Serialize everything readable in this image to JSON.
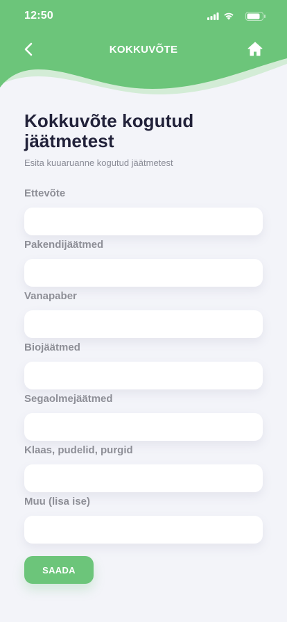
{
  "colors": {
    "accent": "#6cc57a",
    "accent_light": "#d3ecd6",
    "background": "#f3f4f9",
    "title": "#22223a",
    "label": "#8e8f97"
  },
  "status_bar": {
    "time": "12:50",
    "icons": [
      "signal-icon",
      "wifi-icon",
      "battery-icon"
    ]
  },
  "nav": {
    "back_icon": "chevron-left-icon",
    "title": "KOKKUVÕTE",
    "home_icon": "home-icon"
  },
  "page": {
    "title": "Kokkuvõte kogutud jäätmetest",
    "subtitle": "Esita kuuaruanne kogutud jäätmetest"
  },
  "form": {
    "fields": [
      {
        "label": "Ettevõte",
        "value": "",
        "placeholder": ""
      },
      {
        "label": "Pakendijäätmed",
        "value": "",
        "placeholder": ""
      },
      {
        "label": "Vanapaber",
        "value": "",
        "placeholder": ""
      },
      {
        "label": "Biojäätmed",
        "value": "",
        "placeholder": ""
      },
      {
        "label": "Segaolmejäätmed",
        "value": "",
        "placeholder": ""
      },
      {
        "label": "Klaas, pudelid, purgid",
        "value": "",
        "placeholder": ""
      },
      {
        "label": "Muu (lisa ise)",
        "value": "",
        "placeholder": ""
      }
    ],
    "submit_label": "SAADA"
  }
}
